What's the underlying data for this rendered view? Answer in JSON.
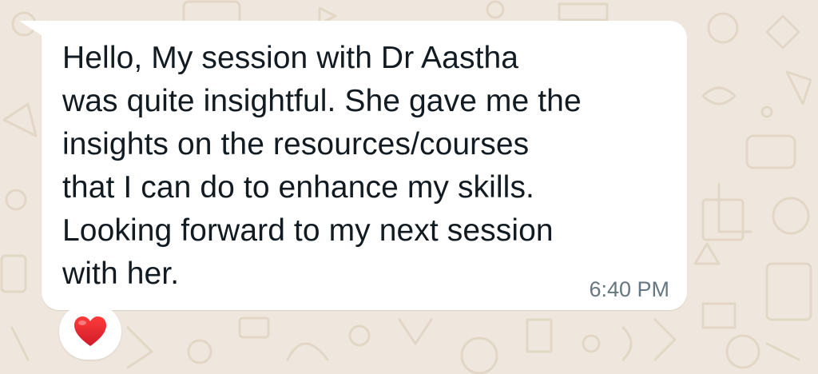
{
  "message": {
    "text": "Hello, My session with Dr Aastha\nwas quite insightful. She gave me the\ninsights on the resources/courses\nthat I can do to enhance my skills.\nLooking forward to my next session\nwith her.",
    "time": "6:40 PM"
  },
  "reaction": {
    "icon": "red-heart-icon",
    "color": "#e0222f"
  },
  "colors": {
    "wallpaper": "#efe7dd",
    "bubble": "#ffffff",
    "text": "#111b21",
    "timestamp": "#667781"
  }
}
